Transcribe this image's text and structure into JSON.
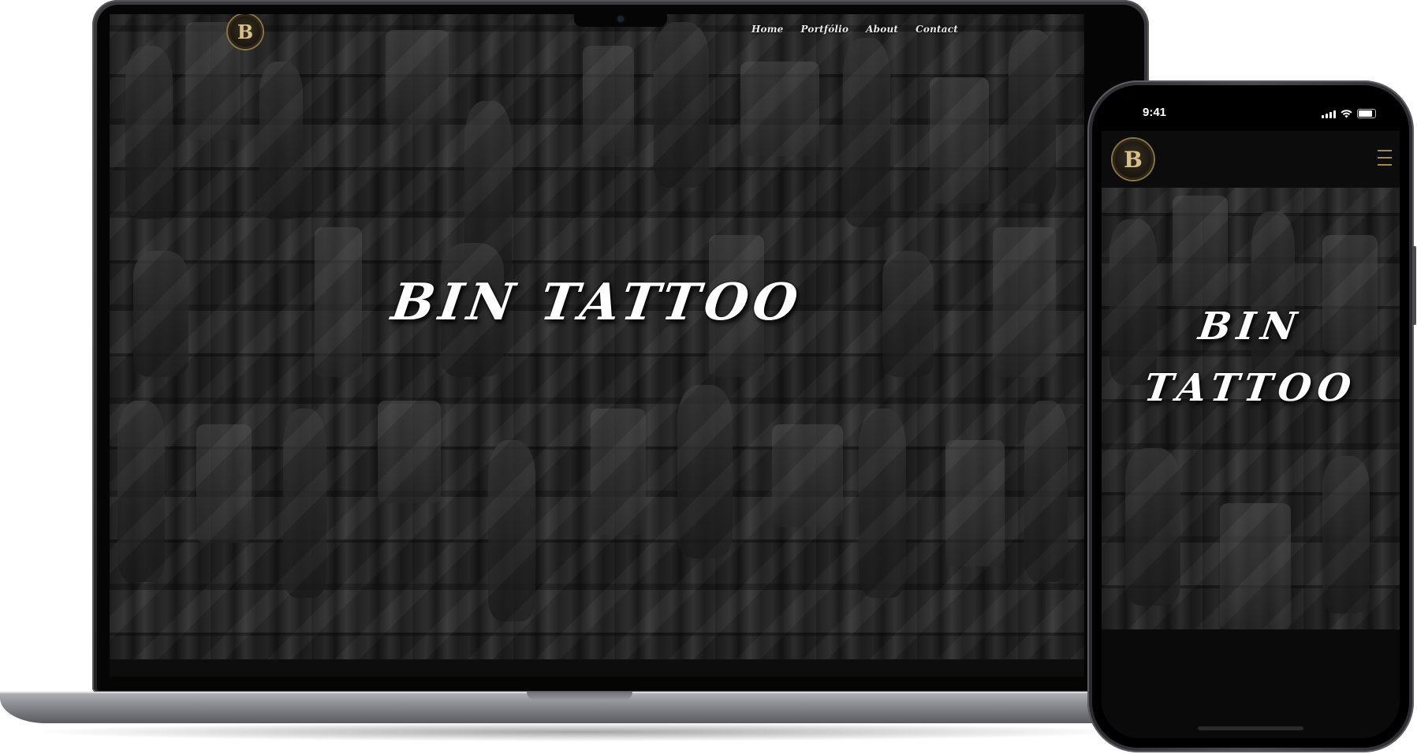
{
  "laptop": {
    "logo_letter": "B",
    "nav": {
      "home": "Home",
      "portfolio": "Portfólio",
      "about": "About",
      "contact": "Contact"
    },
    "hero_title": "BIN TATTOO"
  },
  "phone": {
    "status_time": "9:41",
    "logo_letter": "B",
    "menu_icon": "hamburger-menu-icon",
    "hero_line_1": "BIN",
    "hero_line_2": "TATTOO"
  },
  "colors": {
    "accent_gold": "#a08952",
    "background": "#121212",
    "hero_text": "#ffffff"
  }
}
